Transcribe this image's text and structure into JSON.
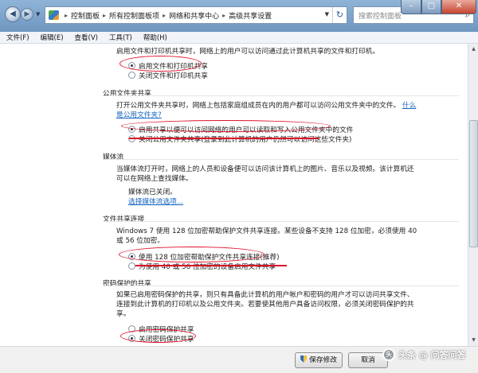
{
  "nav": {
    "back_icon": "back-arrow-icon",
    "forward_icon": "forward-arrow-icon",
    "breadcrumbs": [
      "控制面板",
      "所有控制面板项",
      "网络和共享中心",
      "高级共享设置"
    ],
    "search_placeholder": "搜索控制面板"
  },
  "menu": [
    "文件(F)",
    "编辑(E)",
    "查看(V)",
    "工具(T)",
    "帮助(H)"
  ],
  "file_printer": {
    "intro": "启用文件和打印机共享时，网络上的用户可以访问通过此计算机共享的文件和打印机。",
    "options": [
      "启用文件和打印机共享",
      "关闭文件和打印机共享"
    ],
    "selected": 0
  },
  "public_folder": {
    "title": "公用文件夹共享",
    "intro_line1": "打开公用文件夹共享时，网络上包括家庭组成员在内的用户都可以访问公用文件夹中的文件。",
    "link_part1": "什么",
    "link_part2": "是公用文件夹?",
    "options": [
      "启用共享以便可以访问网络的用户可以读取和写入公用文件夹中的文件",
      "关闭公用文件夹共享(登录到此计算机的用户仍然可以访问这些文件夹)"
    ],
    "selected": 0
  },
  "media": {
    "title": "媒体流",
    "intro_line1": "当媒体流打开时，网络上的人员和设备便可以访问该计算机上的图片、音乐以及视频。该计算机还",
    "intro_line2": "可以在网络上查找媒体。",
    "status": "媒体流已关闭。",
    "link": "选择媒体流选项..."
  },
  "file_sharing": {
    "title": "文件共享连接",
    "intro_line1": "Windows 7 使用 128 位加密帮助保护文件共享连接。某些设备不支持 128 位加密，必须使用 40",
    "intro_line2": "或 56 位加密。",
    "options": [
      "使用 128 位加密帮助保护文件共享连接(推荐)",
      "为使用 40 或 56 位加密的设备启用文件共享"
    ],
    "selected": 0
  },
  "password": {
    "title": "密码保护的共享",
    "intro_line1": "如果已启用密码保护的共享，则只有具备此计算机的用户帐户和密码的用户才可以访问共享文件、",
    "intro_line2": "连接到此计算机的打印机以及公用文件夹。若要使其他用户具备访问权限，必须关闭密码保护的共",
    "intro_line3": "享。",
    "options": [
      "启用密码保护共享",
      "关闭密码保护共享"
    ],
    "selected": 1
  },
  "buttons": {
    "save": "保存修改",
    "cancel": "取消"
  },
  "watermark": {
    "text": "头条 @ 问答问答"
  },
  "colors": {
    "annotation": "#e0112b",
    "link": "#1565c0"
  }
}
